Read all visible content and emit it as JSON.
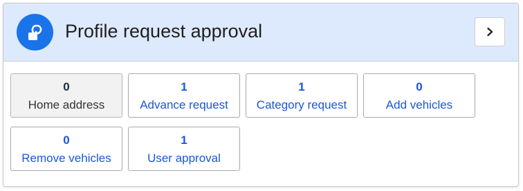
{
  "header": {
    "title": "Profile request approval",
    "icon": "profile-request-icon",
    "expand_icon": "chevron-right-icon"
  },
  "colors": {
    "header_bg": "#dde9fc",
    "accent": "#1a73e8",
    "link": "#1a56db"
  },
  "tiles": [
    {
      "count": "0",
      "label": "Home address",
      "selected": true
    },
    {
      "count": "1",
      "label": "Advance request",
      "selected": false
    },
    {
      "count": "1",
      "label": "Category request",
      "selected": false
    },
    {
      "count": "0",
      "label": "Add vehicles",
      "selected": false
    },
    {
      "count": "0",
      "label": "Remove vehicles",
      "selected": false
    },
    {
      "count": "1",
      "label": "User approval",
      "selected": false
    }
  ]
}
